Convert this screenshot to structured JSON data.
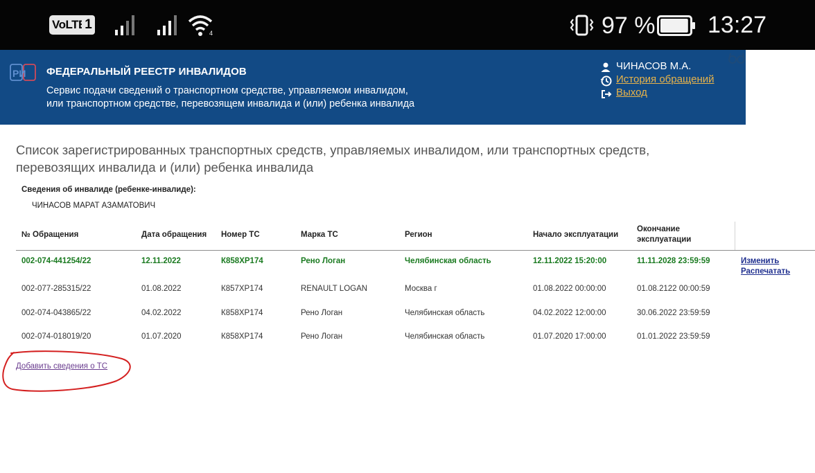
{
  "status_bar": {
    "volte": "VoLTE",
    "sim": "1",
    "battery_percent": "97 %",
    "battery_level": 0.97,
    "time": "13:27"
  },
  "header": {
    "logo": "РИ",
    "title": "ФЕДЕРАЛЬНЫЙ РЕЕСТР ИНВАЛИДОВ",
    "subtitle_line1": "Сервис подачи сведений о транспортном средстве, управляемом инвалидом,",
    "subtitle_line2": "или транспортном средстве, перевозящем инвалида и (или) ребенка инвалида",
    "user": "ЧИНАСОВ М.А.",
    "history_link": "История обращений",
    "exit_link": "Выход"
  },
  "page": {
    "title_line1": "Список зарегистрированных транспортных средств, управляемых инвалидом, или транспортных средств,",
    "title_line2": "перевозящих инвалида и (или) ребенка инвалида",
    "info_label": "Сведения об инвалиде (ребенке-инвалиде):",
    "info_value": "ЧИНАСОВ МАРАТ АЗАМАТОВИЧ",
    "add_link": "Добавить сведения о ТС"
  },
  "table": {
    "headers": {
      "num": "№ Обращения",
      "date": "Дата обращения",
      "plate": "Номер ТС",
      "brand": "Марка ТС",
      "region": "Регион",
      "start": "Начало эксплуатации",
      "end_line1": "Окончание",
      "end_line2": "эксплуатации"
    },
    "rows": [
      {
        "num": "002-074-441254/22",
        "date": "12.11.2022",
        "plate": "К858ХР174",
        "brand": "Рено Логан",
        "region": "Челябинская область",
        "start": "12.11.2022 15:20:00",
        "end": "11.11.2028 23:59:59",
        "action1": "Изменить",
        "action2": "Распечатать"
      },
      {
        "num": "002-077-285315/22",
        "date": "01.08.2022",
        "plate": "К857ХР174",
        "brand": "RENAULT LOGAN",
        "region": "Москва г",
        "start": "01.08.2022 00:00:00",
        "end": "01.08.2122 00:00:59"
      },
      {
        "num": "002-074-043865/22",
        "date": "04.02.2022",
        "plate": "К858ХР174",
        "brand": "Рено Логан",
        "region": "Челябинская область",
        "start": "04.02.2022 12:00:00",
        "end": "30.06.2022 23:59:59"
      },
      {
        "num": "002-074-018019/20",
        "date": "01.07.2020",
        "plate": "К858ХР174",
        "brand": "Рено Логан",
        "region": "Челябинская область",
        "start": "01.07.2020 17:00:00",
        "end": "01.01.2022 23:59:59"
      }
    ]
  },
  "colors": {
    "header_bg": "#124a85",
    "link_gold": "#e8b34a",
    "active_green": "#1a7a20",
    "annotation_red": "#d42020"
  }
}
